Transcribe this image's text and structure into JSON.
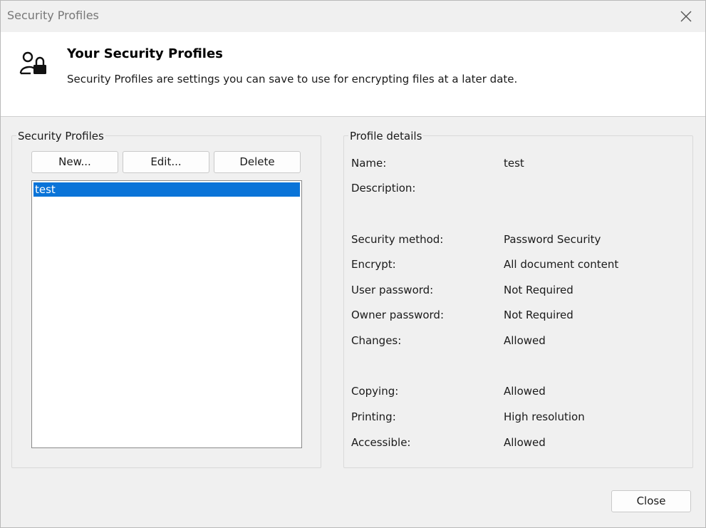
{
  "window": {
    "title": "Security Profiles"
  },
  "header": {
    "title": "Your Security Profiles",
    "description": "Security Profiles are settings you can save to use for encrypting files at a later date.",
    "icon": "user-lock-icon"
  },
  "profiles": {
    "group_label": "Security Profiles",
    "buttons": {
      "new": "New...",
      "edit": "Edit...",
      "delete": "Delete"
    },
    "items": [
      "test"
    ],
    "selected": "test"
  },
  "details": {
    "group_label": "Profile details",
    "rows": [
      {
        "label": "Name:",
        "value": "test"
      },
      {
        "label": "Description:",
        "value": ""
      },
      {
        "label": "Security method:",
        "value": "Password Security"
      },
      {
        "label": "Encrypt:",
        "value": "All document content"
      },
      {
        "label": "User password:",
        "value": "Not Required"
      },
      {
        "label": "Owner password:",
        "value": "Not Required"
      },
      {
        "label": "Changes:",
        "value": "Allowed"
      },
      {
        "label": "Copying:",
        "value": "Allowed"
      },
      {
        "label": "Printing:",
        "value": "High resolution"
      },
      {
        "label": "Accessible:",
        "value": "Allowed"
      }
    ]
  },
  "footer": {
    "close_label": "Close"
  },
  "colors": {
    "selection": "#0a74d8",
    "dialog_bg": "#f0f0f0"
  }
}
